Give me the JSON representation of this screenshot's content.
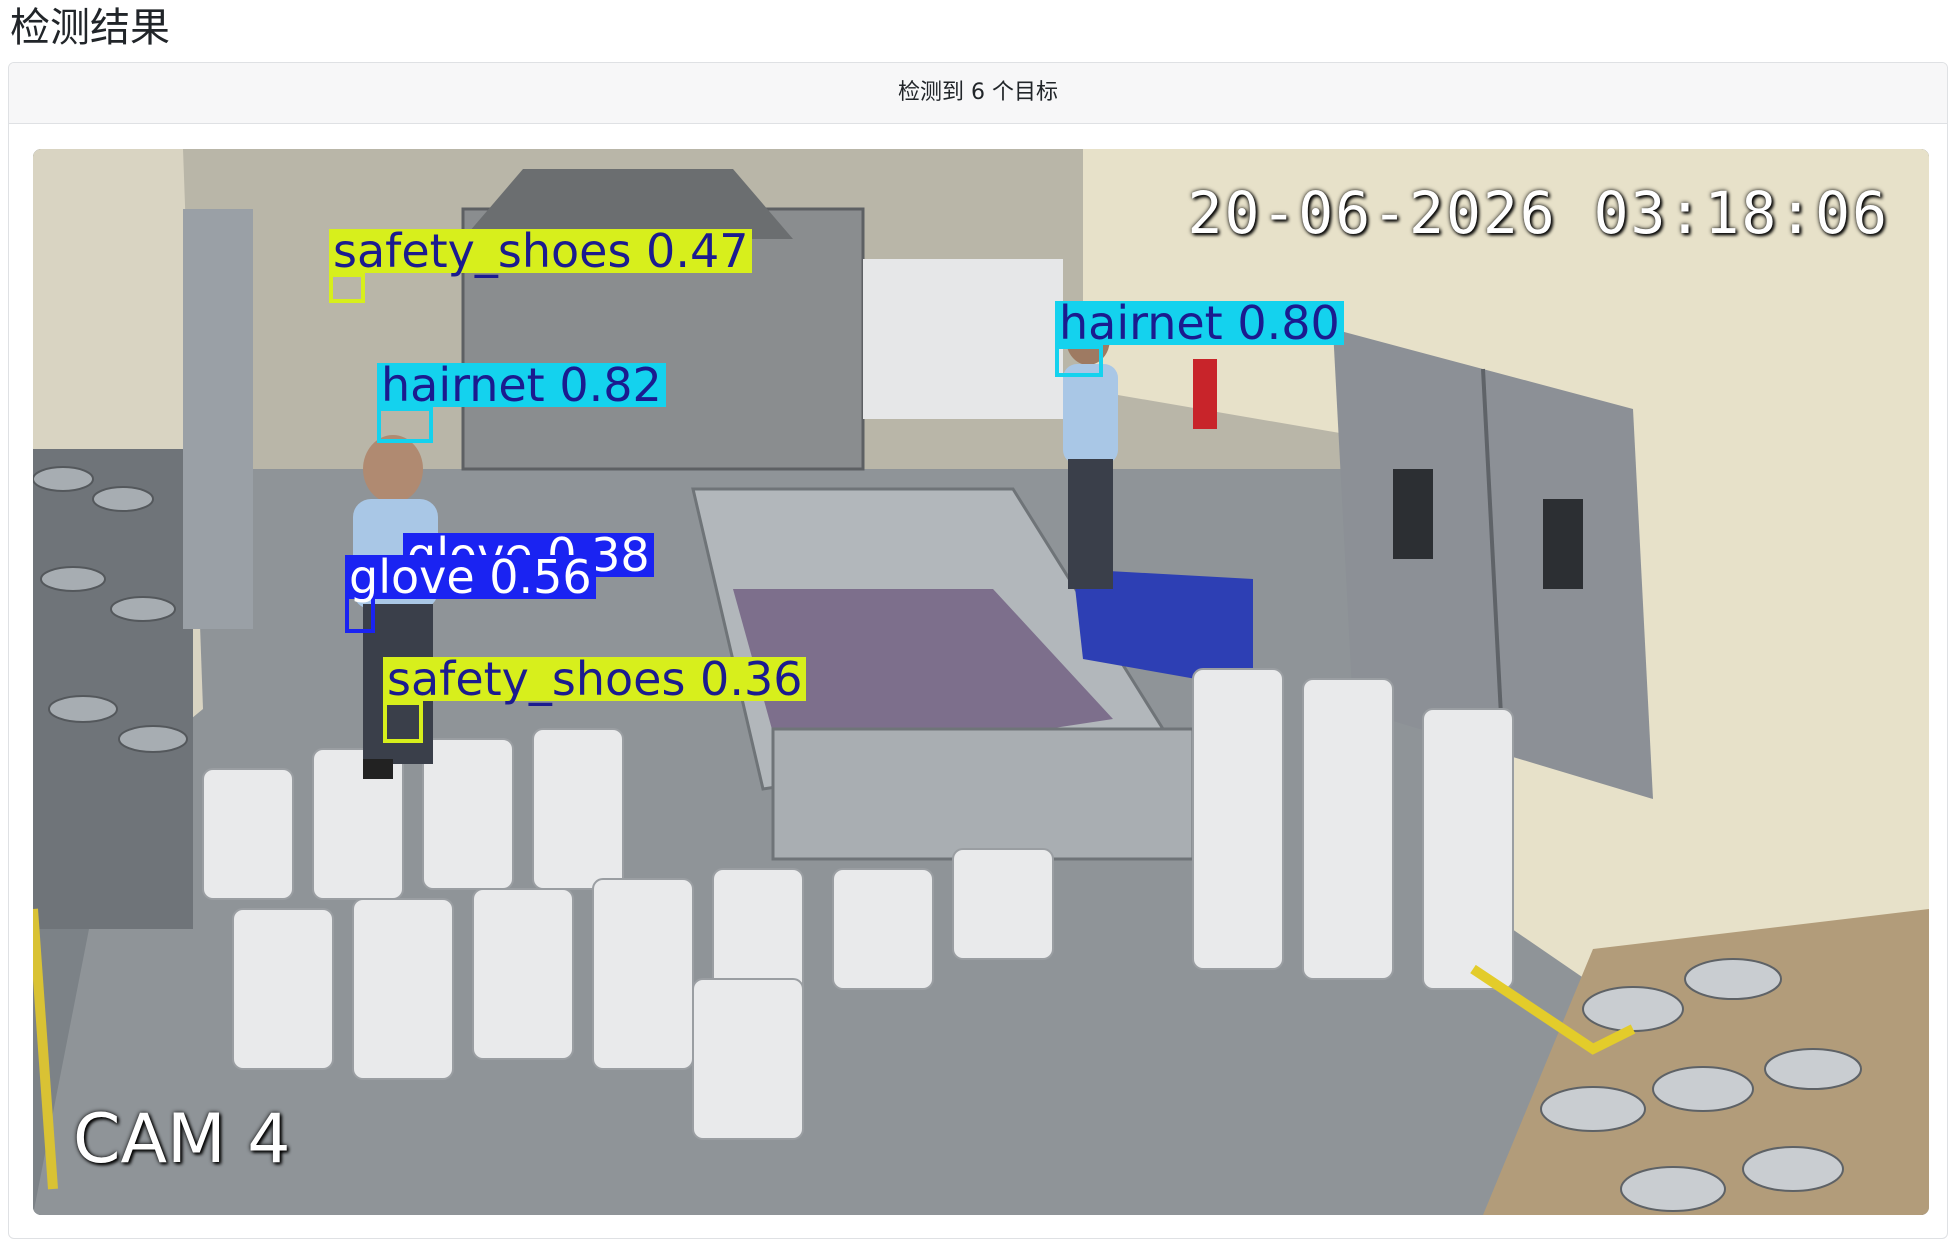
{
  "page": {
    "title": "检测结果"
  },
  "result": {
    "summary": "检测到 6 个目标"
  },
  "image": {
    "timestamp": "20-06-2026 03:18:06",
    "camera": "CAM 4"
  },
  "colors": {
    "safety_shoes": "#d7ef1c",
    "hairnet": "#14d2ee",
    "glove": "#1a23f2"
  },
  "detections": [
    {
      "label": "safety_shoes 0.47",
      "class": "safety_shoes"
    },
    {
      "label": "hairnet 0.82",
      "class": "hairnet"
    },
    {
      "label": "hairnet 0.80",
      "class": "hairnet"
    },
    {
      "label": "glove 0.38",
      "class": "glove"
    },
    {
      "label": "glove 0.56",
      "class": "glove"
    },
    {
      "label": "safety_shoes 0.36",
      "class": "safety_shoes"
    }
  ]
}
